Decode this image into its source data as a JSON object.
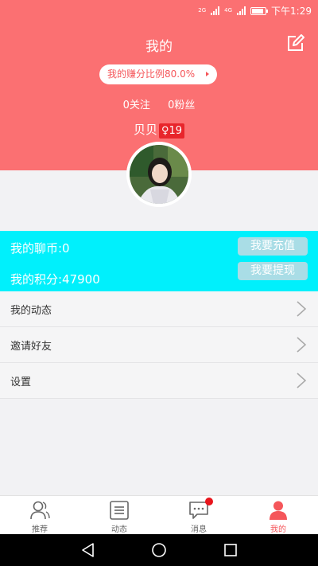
{
  "status_bar": {
    "time": "下午1:29",
    "net1": "2G",
    "net2": "4G"
  },
  "header": {
    "title": "我的",
    "ratio_label": "我的赚分比例80.0%",
    "following": "0关注",
    "fans": "0粉丝",
    "username": "贝贝",
    "gender_symbol": "♀",
    "age": "19"
  },
  "wallet": {
    "coins": "我的聊币:0",
    "points": "我的积分:47900",
    "recharge": "我要充值",
    "withdraw": "我要提现"
  },
  "menu": [
    {
      "label": "我的动态"
    },
    {
      "label": "邀请好友"
    },
    {
      "label": "设置"
    }
  ],
  "tabs": [
    {
      "label": "推荐",
      "icon": "user-icon"
    },
    {
      "label": "动态",
      "icon": "list-icon"
    },
    {
      "label": "消息",
      "icon": "chat-icon"
    },
    {
      "label": "我的",
      "icon": "profile-icon"
    }
  ],
  "colors": {
    "header": "#fb7072",
    "wallet": "#00f0fc",
    "accent": "#f5565a"
  }
}
